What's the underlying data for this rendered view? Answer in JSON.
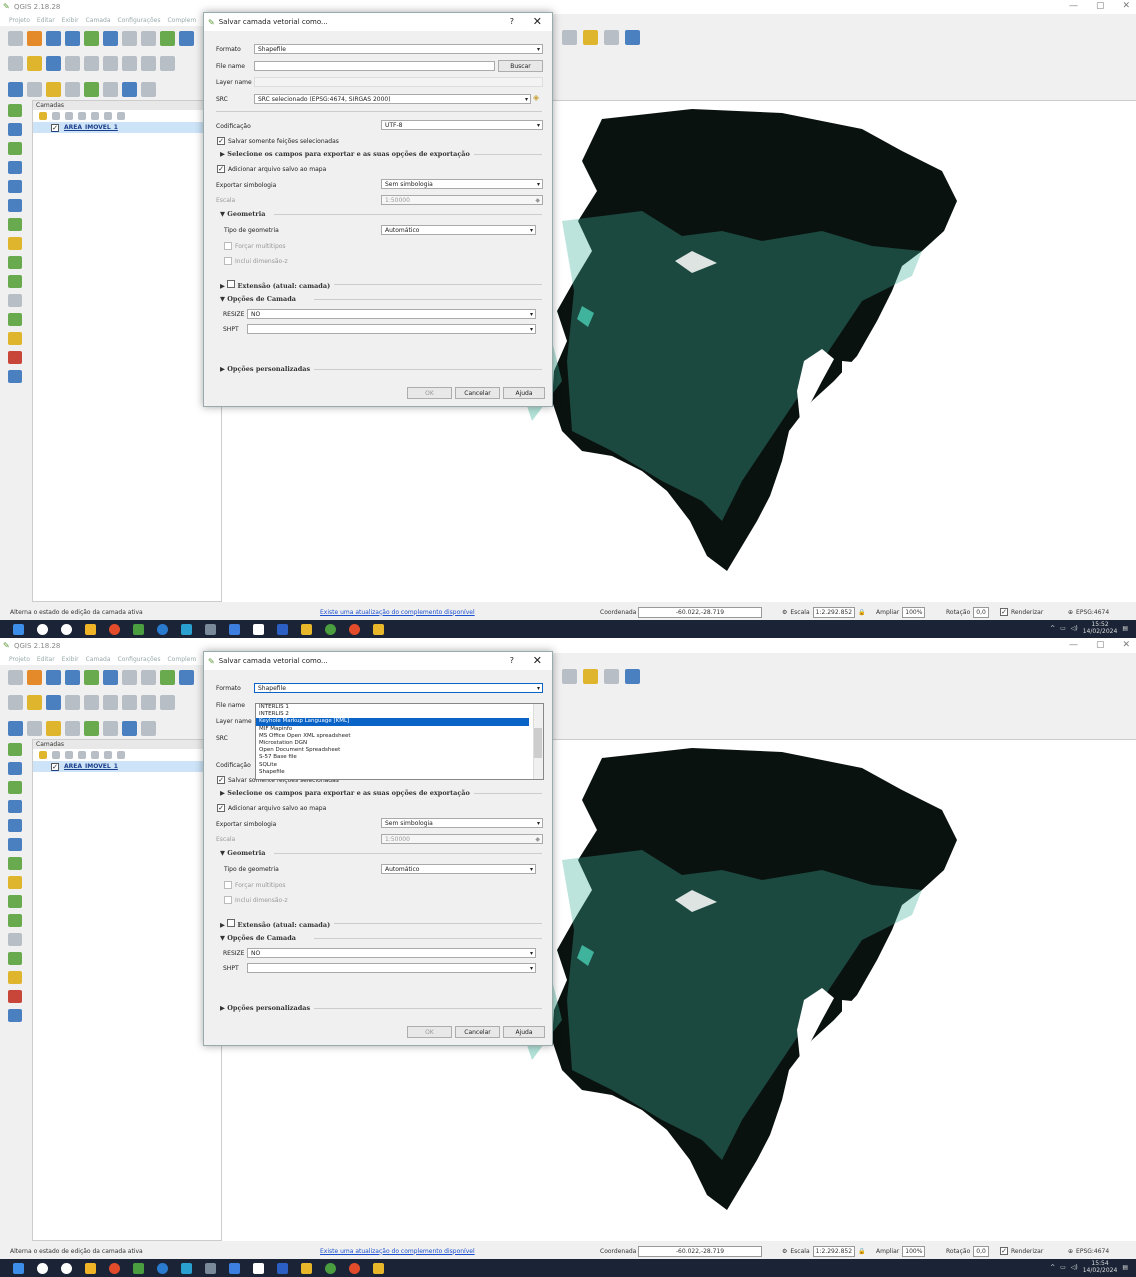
{
  "app": {
    "title": "QGIS 2.18.28",
    "menus": [
      "Projeto",
      "Editar",
      "Exibir",
      "Camada",
      "Configurações",
      "Complem"
    ]
  },
  "layers_panel": {
    "title": "Camadas",
    "layer_name": "AREA_IMOVEL_1"
  },
  "statusbar": {
    "message": "Alterna o estado de edição da camada ativa",
    "update_link": "Existe uma atualização do complemento disponível",
    "coord_label": "Coordenada",
    "coord_value": "-60.022,-28.719",
    "scale_label": "Escala",
    "scale_value": "1:2.292.852",
    "zoom_label": "Ampliar",
    "zoom_value": "100%",
    "rotation_label": "Rotação",
    "rotation_value": "0,0",
    "render_label": "Renderizar",
    "crs_label": "EPSG:4674"
  },
  "taskbar": {
    "screens": [
      {
        "time": "15:52",
        "date": "14/02/2024"
      },
      {
        "time": "15:54",
        "date": "14/02/2024"
      }
    ]
  },
  "dialog": {
    "title": "Salvar camada vetorial como...",
    "help": "?",
    "format_label": "Formato",
    "format_value": "Shapefile",
    "filename_label": "File name",
    "browse_button": "Buscar",
    "layername_label": "Layer name",
    "src_label": "SRC",
    "src_value": "SRC selecionado (EPSG:4674, SIRGAS 2000)",
    "encoding_label": "Codificação",
    "encoding_value": "UTF-8",
    "save_selected_label": "Salvar somente feições selecionadas",
    "select_fields_label": "Selecione os campos para exportar e as suas opções de exportação",
    "add_to_map_label": "Adicionar arquivo salvo ao mapa",
    "symbology_label": "Exportar simbologia",
    "symbology_value": "Sem simbologia",
    "scale_label": "Escala",
    "scale_value": "1:50000",
    "geometry_section": "Geometria",
    "geom_type_label": "Tipo de geometria",
    "geom_type_value": "Automático",
    "force_multi_label": "Forçar multitipos",
    "include_z_label": "Inclui dimensão-z",
    "extent_section": "Extensão (atual: camada)",
    "layer_options_section": "Opções de Camada",
    "resize_label": "RESIZE",
    "resize_value": "NO",
    "shpt_label": "SHPT",
    "custom_options_section": "Opções personalizadas",
    "ok_button": "OK",
    "cancel_button": "Cancelar",
    "help_button": "Ajuda"
  },
  "format_dropdown": {
    "options": [
      "INTERLIS 1",
      "INTERLIS 2",
      "Keyhole Markup Language [KML]",
      "MIF Mapinfo",
      "MS Office Open XML spreadsheet",
      "Microstation DGN",
      "Open Document Spreadsheet",
      "S-57 Base file",
      "SQLite",
      "Shapefile"
    ],
    "highlighted": "Keyhole Markup Language [KML]"
  },
  "colors": {
    "map_dark": "#0a120f",
    "map_teal": "#3fb39c",
    "selection_blue": "#0a64c8",
    "taskbar": "#1a2436"
  }
}
